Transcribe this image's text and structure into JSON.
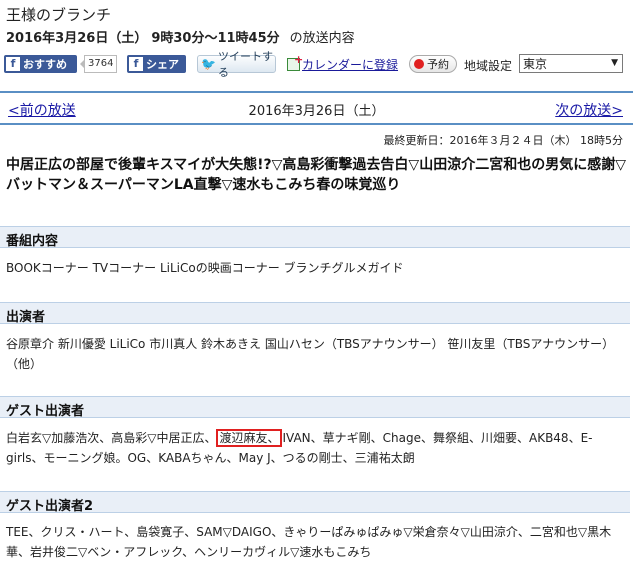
{
  "program": {
    "title": "王様のブランチ",
    "airdate": "2016年3月26日（土）",
    "airtime": "9時30分～11時45分",
    "suffix": "の放送内容"
  },
  "toolbar": {
    "fb_recommend_label": "おすすめ",
    "fb_count": "3764",
    "fb_share_label": "シェア",
    "tweet_label": "ツイートする",
    "calendar_label": "カレンダーに登録",
    "reserve_label": "予約",
    "region_label": "地域設定",
    "region_value": "東京"
  },
  "nav": {
    "prev_label": "<前の放送",
    "date": "2016年3月26日（土）",
    "next_label": "次の放送>"
  },
  "updated": "最終更新日：2016年３月２４日（木） 18時5分",
  "headline": "中居正広の部屋で後輩キスマイが大失態!?▽高島彩衝撃過去告白▽山田涼介二宮和也の男気に感謝▽バットマン＆スーパーマンLA直撃▽速水もこみち春の味覚巡り",
  "sections": {
    "content": {
      "heading": "番組内容",
      "body": "BOOKコーナー TVコーナー LiLiCoの映画コーナー ブランチグルメガイド"
    },
    "cast": {
      "heading": "出演者",
      "body": "谷原章介 新川優愛 LiLiCo 市川真人 鈴木あきえ 国山ハセン（TBSアナウンサー） 笹川友里（TBSアナウンサー）（他）"
    },
    "guests": {
      "heading": "ゲスト出演者",
      "body_before": "白岩玄▽加藤浩次、高島彩▽中居正広、",
      "highlight": "渡辺麻友、",
      "body_after": "IVAN、草ナギ剛、Chage、舞祭組、川畑要、AKB48、E-girls、モーニング娘。OG、KABAちゃん、May J、つるの剛士、三浦祐太朗"
    },
    "guests2": {
      "heading": "ゲスト出演者2",
      "body": "TEE、クリス・ハート、島袋寛子、SAM▽DAIGO、きゃりーぱみゅぱみゅ▽栄倉奈々▽山田涼介、二宮和也▽黒木華、岩井俊二▽ベン・アフレック、ヘンリーカヴィル▽速水もこみち"
    }
  },
  "colors": {
    "facebook": "#3b5998",
    "link": "#1a1aa6",
    "section_bg": "#e9eff7",
    "highlight_border": "#e02020"
  }
}
